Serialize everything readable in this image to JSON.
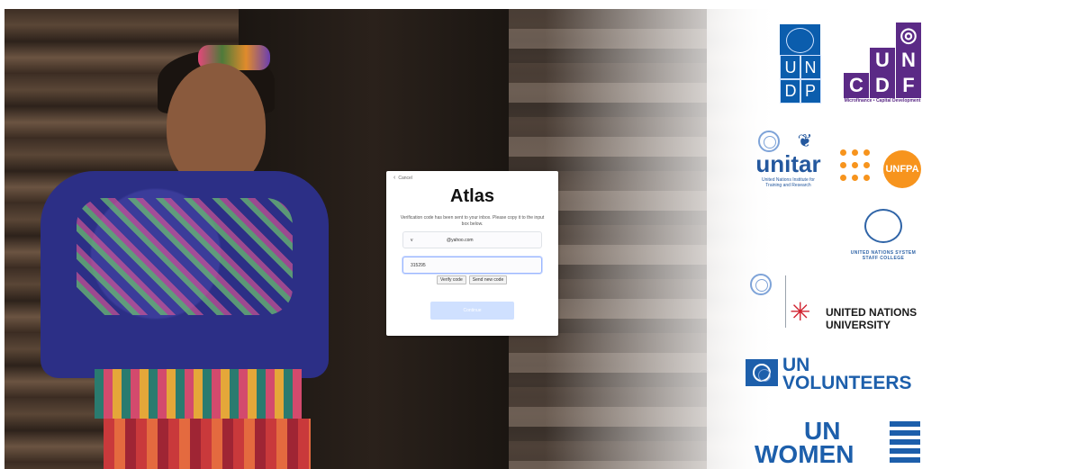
{
  "modal": {
    "cancel_label": "Cancel",
    "title": "Atlas",
    "description": "Verification code has been sent to your inbox. Please copy it to the input box below.",
    "email_prefix": "v",
    "email_value": "@yahoo.com",
    "code_value": "315295",
    "verify_label": "Verify code",
    "send_new_label": "Send new code",
    "continue_label": "Continue"
  },
  "logos": {
    "undp": [
      "U",
      "N",
      "D",
      "P"
    ],
    "uncdf": {
      "letters": [
        "U",
        "N",
        "C",
        "D",
        "F"
      ],
      "tagline": "Microfinance • Capital Development"
    },
    "unitar": {
      "name": "unitar",
      "subtitle": "United Nations Institute for Training and Research"
    },
    "unfpa": {
      "name": "UNFPA"
    },
    "unssc": {
      "name": "UNITED NATIONS SYSTEM STAFF COLLEGE"
    },
    "unu": {
      "name": "UNITED NATIONS UNIVERSITY"
    },
    "unv": {
      "line1": "UN",
      "line2": "VOLUNTEERS"
    },
    "unwomen": {
      "line1": "UN",
      "line2": "WOMEN"
    }
  },
  "icons": {
    "back": "chevron-left-icon",
    "un_emblem": "un-emblem-icon"
  },
  "colors": {
    "accent": "#0b5dad",
    "continue_disabled": "#cfe0ff",
    "unfpa_orange": "#f7941d",
    "uncdf_purple": "#5b2a86",
    "unu_red": "#d1222f"
  }
}
